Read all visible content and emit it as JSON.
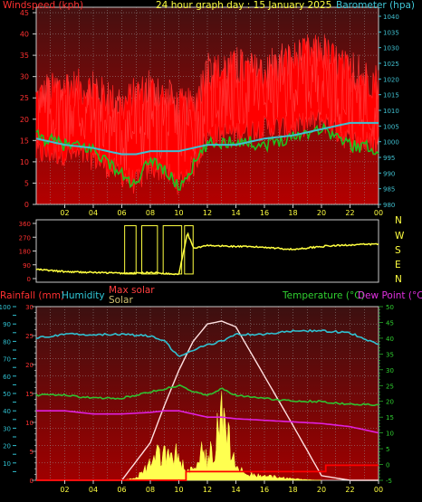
{
  "header": {
    "windspeed_label": "Windspeed (kph)",
    "title": "24 hour graph day : 15 January 2025",
    "barometer_label": "Barometer (hpa)"
  },
  "wind_dir_labels": [
    "N",
    "W",
    "S",
    "E",
    "N"
  ],
  "bottom_header": {
    "rainfall_label": "Rainfall (mm)",
    "humidity_label": "Humidity",
    "max_solar_label": "Max solar",
    "solar_label": "Solar",
    "temperature_label": "Temperature (°C)",
    "dewpoint_label": "Dew Point (°C)"
  },
  "colors": {
    "wind": "#ff2020",
    "gust_fill": "#ff0000",
    "barometer": "#40c0d0",
    "gust_avg": "#20c020",
    "direction": "#ffff40",
    "humidity": "#30c0d0",
    "temperature": "#30c030",
    "dewpoint": "#e020e0",
    "solar": "#ffff50",
    "max_solar": "#ffe0e0",
    "rain": "#ff0000",
    "bg_top": "#4a1010",
    "bg_bottom": "#aa0000"
  },
  "chart_data": [
    {
      "type": "line",
      "name": "wind",
      "x_ticks": [
        "02",
        "04",
        "06",
        "08",
        "10",
        "12",
        "14",
        "16",
        "18",
        "20",
        "22",
        "00"
      ],
      "y_left_ticks": [
        0,
        5,
        10,
        15,
        20,
        25,
        30,
        35,
        40,
        45
      ],
      "ylim_left": [
        0,
        45
      ],
      "y_right_ticks": [
        980,
        985,
        990,
        995,
        1000,
        1005,
        1010,
        1015,
        1020,
        1025,
        1030,
        1035,
        1040
      ],
      "ylim_right": [
        980,
        1040
      ],
      "hours": [
        0,
        2,
        4,
        6,
        7,
        8,
        9,
        10,
        11,
        12,
        14,
        16,
        18,
        20,
        22,
        24
      ],
      "wind_gust_upper": [
        24,
        27,
        26,
        22,
        25,
        26,
        24,
        22,
        22,
        30,
        31,
        30,
        33,
        35,
        30,
        28
      ],
      "wind_gust_lower": [
        12,
        12,
        11,
        7,
        5,
        9,
        8,
        5,
        9,
        16,
        17,
        18,
        18,
        20,
        15,
        14
      ],
      "wind_avg": [
        16,
        14,
        13,
        7,
        4,
        11,
        8,
        4,
        9,
        14,
        15,
        14,
        16,
        18,
        14,
        13
      ],
      "barometer": [
        1001,
        999,
        998,
        996,
        996,
        997,
        997,
        997,
        998,
        999,
        999,
        1001,
        1002,
        1004,
        1006,
        1006
      ]
    },
    {
      "type": "line",
      "name": "wind_direction",
      "y_ticks": [
        0,
        90,
        180,
        270,
        360
      ],
      "ylim": [
        0,
        360
      ],
      "hours": [
        0,
        2,
        4,
        6,
        7,
        8,
        8.8,
        9.5,
        10,
        10.6,
        11,
        12,
        14,
        16,
        18,
        20,
        22,
        24
      ],
      "direction": [
        60,
        45,
        40,
        35,
        35,
        40,
        35,
        30,
        30,
        300,
        200,
        215,
        210,
        205,
        190,
        210,
        220,
        225
      ]
    },
    {
      "type": "line",
      "name": "lower",
      "y_left_humidity_ticks": [
        5,
        10,
        15,
        20,
        25,
        30,
        35,
        40,
        45,
        50,
        55,
        60,
        65,
        70,
        75,
        80,
        85,
        90,
        95,
        100
      ],
      "ylim_humidity": [
        0,
        100
      ],
      "y_left_rain_ticks": [
        0,
        5,
        10,
        15,
        20,
        25,
        30
      ],
      "ylim_rain": [
        0,
        30
      ],
      "y_right_ticks": [
        -5,
        0,
        5,
        10,
        15,
        20,
        25,
        30,
        35,
        40,
        45,
        50
      ],
      "ylim_temp": [
        -5,
        50
      ],
      "hours": [
        0,
        2,
        4,
        6,
        8,
        9,
        10,
        11,
        12,
        13,
        14,
        16,
        18,
        20,
        22,
        24
      ],
      "humidity": [
        82,
        84,
        84,
        84,
        83,
        80,
        71,
        75,
        78,
        80,
        84,
        84,
        86,
        86,
        85,
        78
      ],
      "temperature": [
        22,
        22,
        21,
        21,
        23,
        24,
        25,
        23,
        22,
        24,
        22,
        21,
        20,
        20,
        19,
        19
      ],
      "dewpoint": [
        17,
        17,
        16,
        16,
        16.5,
        17,
        17,
        16,
        15,
        15,
        14.5,
        14,
        13.5,
        13,
        12,
        10
      ],
      "max_solar": [
        0,
        0,
        0,
        0,
        6.5,
        13,
        19,
        24,
        27,
        27.5,
        26.5,
        18,
        9.5,
        0.8,
        0,
        0
      ],
      "solar_hours": [
        6,
        7,
        7.5,
        8,
        8.5,
        9,
        9.5,
        10,
        10.5,
        11,
        11.5,
        12,
        12.5,
        13,
        13.5,
        14,
        14.5,
        15,
        16,
        17,
        18,
        19,
        20
      ],
      "solar": [
        0,
        0.5,
        2,
        3,
        5,
        6,
        4,
        6,
        2,
        2,
        6,
        4,
        7,
        13,
        9,
        3,
        2,
        1.2,
        0.8,
        0.6,
        0.3,
        0.1,
        0
      ],
      "rain_hours": [
        0,
        10.5,
        10.5,
        20.3,
        20.3,
        24
      ],
      "rain_total": [
        0,
        0,
        1.5,
        1.5,
        2.6,
        2.6
      ]
    }
  ]
}
